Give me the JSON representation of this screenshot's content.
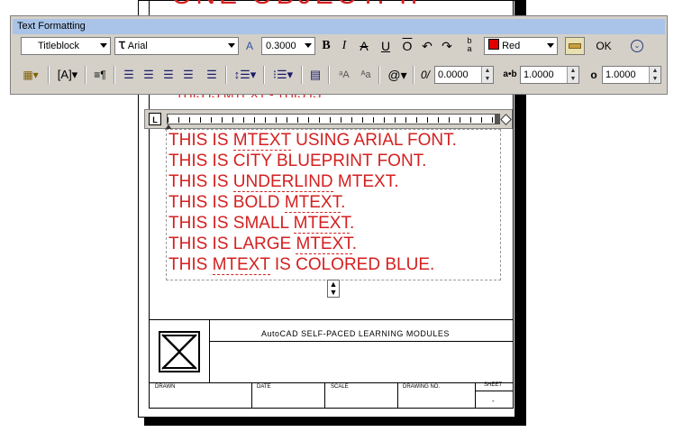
{
  "drawing": {
    "top_text": "ONE OBJECT.    II",
    "ghost_line": "THIS IS MTEXT - THIS IS",
    "mtext_lines": [
      {
        "pre": "THIS IS ",
        "ul": "MTEXT",
        "post": " USING ARIAL FONT."
      },
      {
        "pre": "THIS IS CITY BLUEPRINT FONT.",
        "ul": "",
        "post": ""
      },
      {
        "pre": "THIS IS ",
        "ul": "UNDERLIND",
        "post": " MTEXT."
      },
      {
        "pre": "THIS IS BOLD ",
        "ul": "MTEXT",
        "post": "."
      },
      {
        "pre": "THIS IS SMALL ",
        "ul": "MTEXT",
        "post": "."
      },
      {
        "pre": "THIS IS LARGE ",
        "ul": "MTEXT",
        "post": "."
      },
      {
        "pre": "THIS ",
        "ul": "MTEXT",
        "post": " IS COLORED BLUE."
      }
    ],
    "text_color": "#d42020"
  },
  "titleblock": {
    "heading": "AutoCAD  SELF-PACED  LEARNING  MODULES",
    "fields": [
      "DRAWN",
      "DATE",
      "SCALE",
      "DRAWING NO.",
      "SHEET"
    ],
    "sheet_value": "-"
  },
  "toolbar": {
    "title": "Text Formatting",
    "style": "Titleblock",
    "font": "Arial",
    "height": "0.3000",
    "color": "Red",
    "ok_label": "OK",
    "oblique": "0.0000",
    "tracking": "1.0000",
    "width_factor": "1.0000",
    "title_color": "#a9c4e8"
  },
  "ruler": {
    "label": "L"
  }
}
